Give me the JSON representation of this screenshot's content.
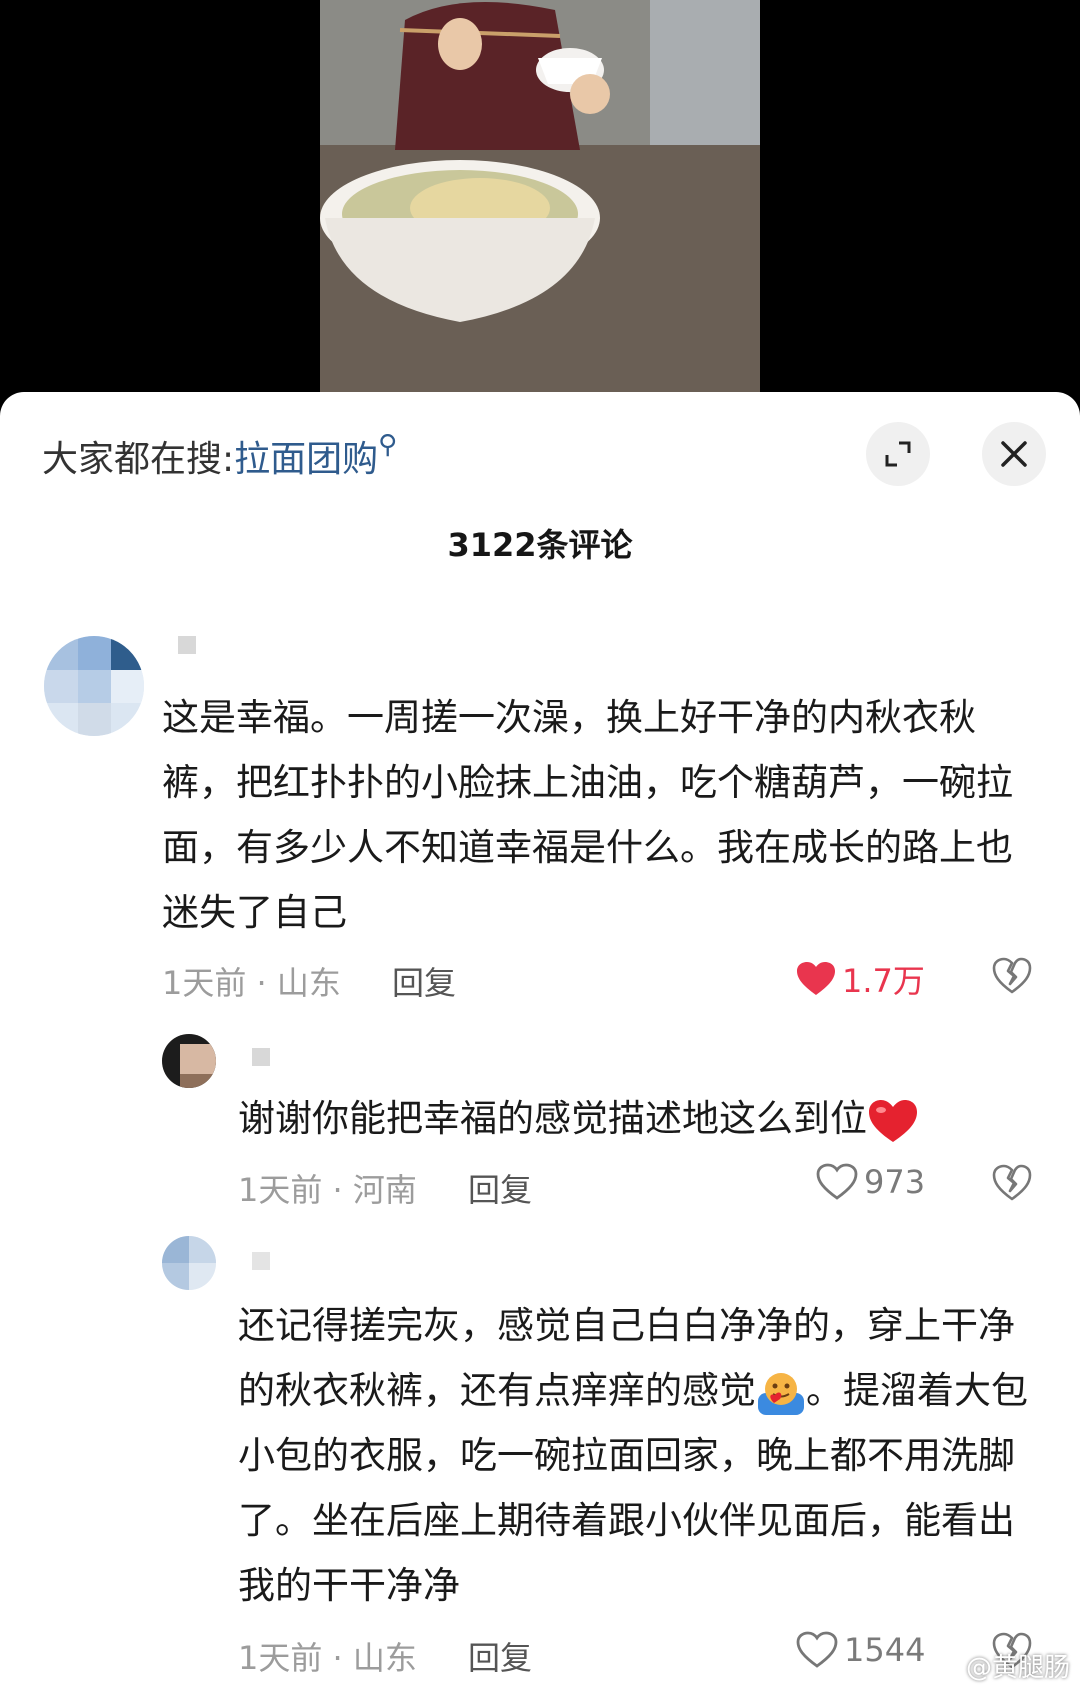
{
  "header": {
    "search_prefix": "大家都在搜:",
    "search_keyword": "拉面团购",
    "expand_icon": "expand-icon",
    "close_icon": "close-icon"
  },
  "comments_count": "3122条评论",
  "comments": [
    {
      "text": "这是幸福。一周搓一次澡，换上好干净的内秋衣秋裤，把红扑扑的小脸抹上油油，吃个糖葫芦，一碗拉面，有多少人不知道幸福是什么。我在成长的路上也迷失了自己",
      "time": "1天前 · 山东",
      "reply": "回复",
      "likes": "1.7万",
      "liked": true
    },
    {
      "text": "谢谢你能把幸福的感觉描述地这么到位",
      "time": "1天前 · 河南",
      "reply": "回复",
      "likes": "973",
      "liked": false
    },
    {
      "text_a": "还记得搓完灰，感觉自己白白净净的，穿上干净的秋衣秋裤，还有点痒痒的感觉",
      "text_b": "。提溜着大包小包的衣服，吃一碗拉面回家，晚上都不用洗脚了。坐在后座上期待着跟小伙伴见面后，能看出我的干干净净",
      "time": "1天前 · 山东",
      "reply": "回复",
      "likes": "1544",
      "liked": false
    }
  ],
  "watermark": "@黄腿肠",
  "colors": {
    "accent_red": "#e9354e",
    "link_blue": "#2f5b8d"
  }
}
